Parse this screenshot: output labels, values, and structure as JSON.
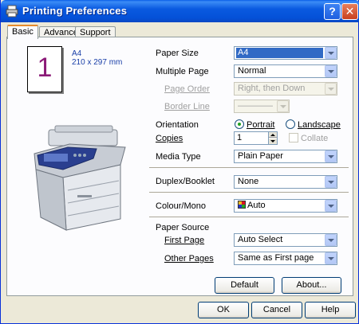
{
  "window": {
    "title": "Printing Preferences"
  },
  "tabs": [
    {
      "label": "Basic"
    },
    {
      "label": "Advanced"
    },
    {
      "label": "Support"
    }
  ],
  "preview": {
    "page_number": "1",
    "size_name": "A4",
    "size_dims": "210 x 297 mm"
  },
  "form": {
    "paper_size": {
      "label": "Paper Size",
      "value": "A4"
    },
    "multiple_page": {
      "label": "Multiple Page",
      "value": "Normal"
    },
    "page_order": {
      "label": "Page Order",
      "value": "Right, then Down"
    },
    "border_line": {
      "label": "Border Line",
      "value": "————"
    },
    "orientation": {
      "label": "Orientation",
      "portrait": "Portrait",
      "landscape": "Landscape",
      "selected": "Portrait"
    },
    "copies": {
      "label": "Copies",
      "value": "1",
      "collate": "Collate"
    },
    "media_type": {
      "label": "Media Type",
      "value": "Plain Paper"
    },
    "duplex": {
      "label": "Duplex/Booklet",
      "value": "None"
    },
    "colour_mono": {
      "label": "Colour/Mono",
      "value": "Auto"
    },
    "paper_source": {
      "label": "Paper Source"
    },
    "first_page": {
      "label": "First Page",
      "value": "Auto Select"
    },
    "other_pages": {
      "label": "Other Pages",
      "value": "Same as First page"
    }
  },
  "buttons": {
    "default": "Default",
    "about": "About...",
    "ok": "OK",
    "cancel": "Cancel",
    "help": "Help"
  }
}
